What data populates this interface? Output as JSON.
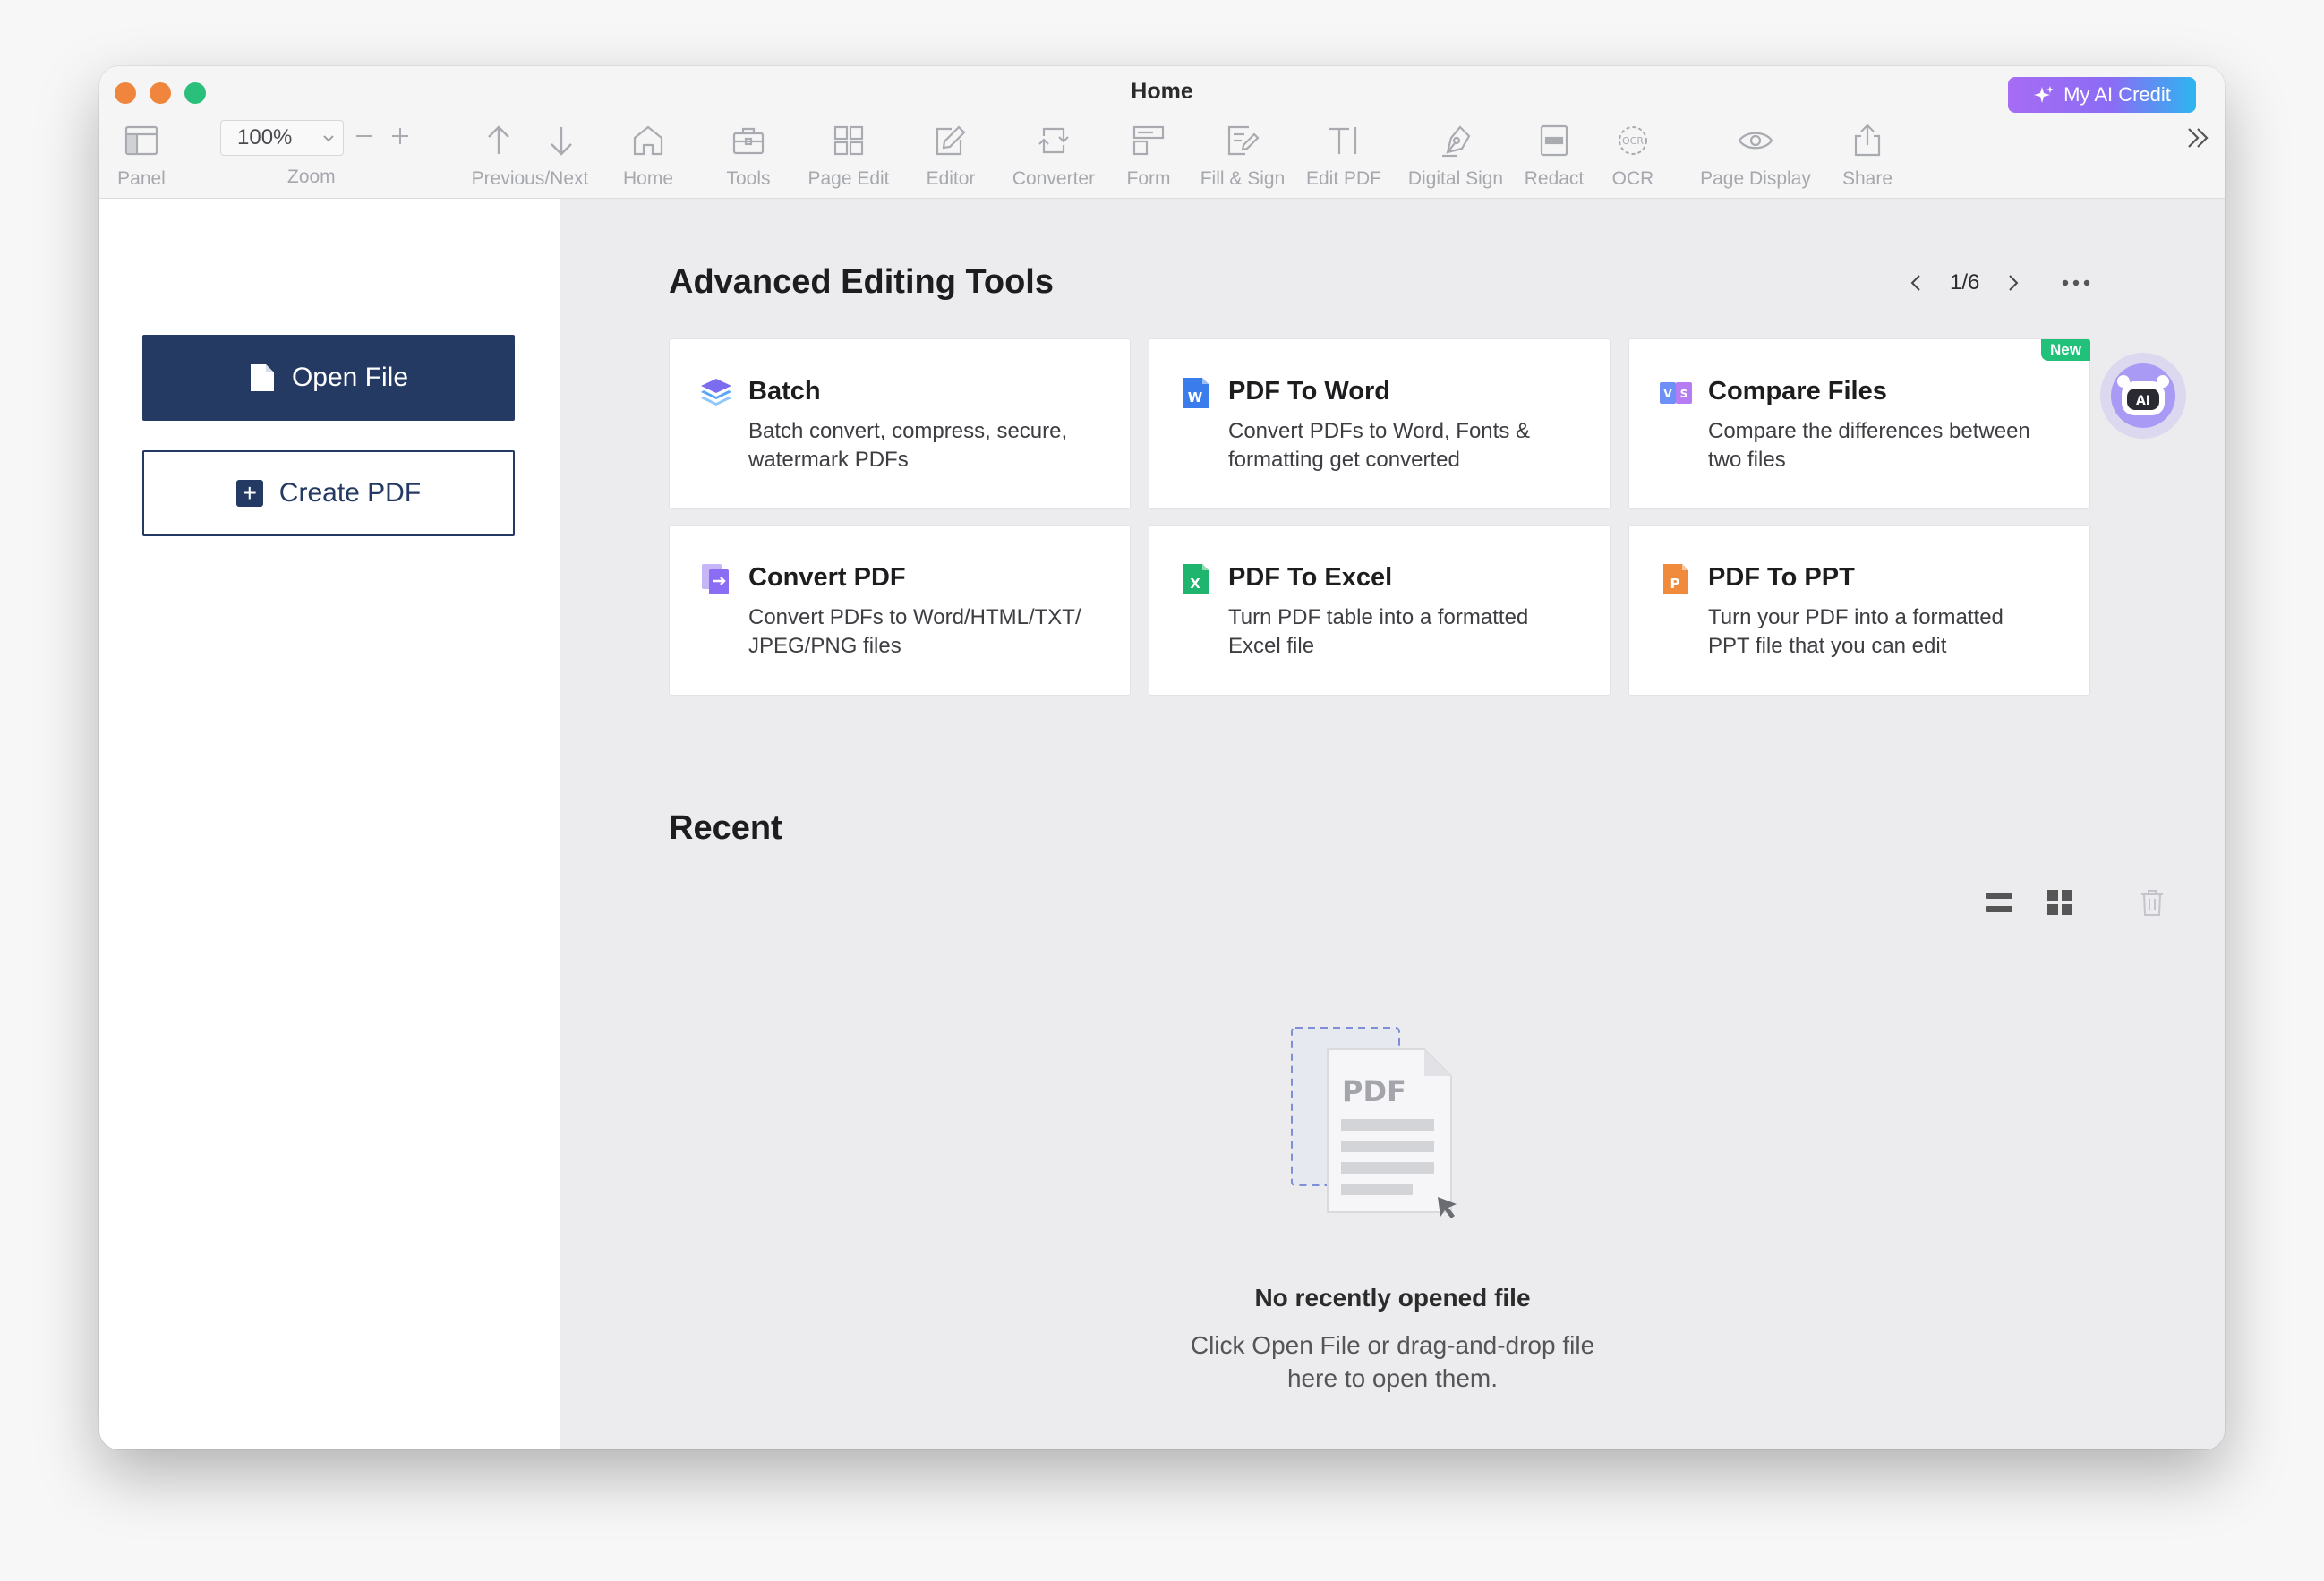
{
  "window": {
    "title": "Home"
  },
  "ai_credit": {
    "label": "My AI Credit"
  },
  "toolbar": {
    "panel": "Panel",
    "zoom_value": "100%",
    "zoom": "Zoom",
    "prev_next": "Previous/Next",
    "home": "Home",
    "tools": "Tools",
    "page_edit": "Page Edit",
    "editor": "Editor",
    "converter": "Converter",
    "form": "Form",
    "fill_sign": "Fill & Sign",
    "edit_pdf": "Edit PDF",
    "digital_sign": "Digital Sign",
    "redact": "Redact",
    "ocr": "OCR",
    "page_display": "Page Display",
    "share": "Share"
  },
  "sidebar": {
    "open_file": "Open File",
    "create_pdf": "Create PDF"
  },
  "tools_section": {
    "title": "Advanced Editing Tools",
    "page_indicator": "1/6",
    "cards": [
      {
        "title": "Batch",
        "desc_1": "Batch convert, compress, secure,",
        "desc_2": "watermark PDFs"
      },
      {
        "title": "PDF To Word",
        "desc_1": "Convert PDFs to Word, Fonts &",
        "desc_2": "formatting get converted"
      },
      {
        "title": "Compare Files",
        "desc_1": "Compare the differences between",
        "desc_2": "two files",
        "badge": "New"
      },
      {
        "title": "Convert PDF",
        "desc_1": "Convert PDFs to Word/HTML/TXT/",
        "desc_2": "JPEG/PNG files"
      },
      {
        "title": "PDF To Excel",
        "desc_1": "Turn PDF table into a formatted",
        "desc_2": "Excel file"
      },
      {
        "title": "PDF To PPT",
        "desc_1": "Turn your PDF into a formatted",
        "desc_2": "PPT file that you can edit"
      }
    ]
  },
  "recent": {
    "title": "Recent",
    "empty_title": "No recently opened file",
    "empty_desc_1": "Click Open File or drag-and-drop file",
    "empty_desc_2": "here to open them.",
    "illustration_text": "PDF"
  },
  "colors": {
    "primary": "#243a63",
    "new_badge": "#21c17a",
    "word_blue": "#3b7ced",
    "excel_green": "#1fb56f",
    "ppt_orange": "#f08a3c",
    "purple": "#8b6cf5"
  }
}
